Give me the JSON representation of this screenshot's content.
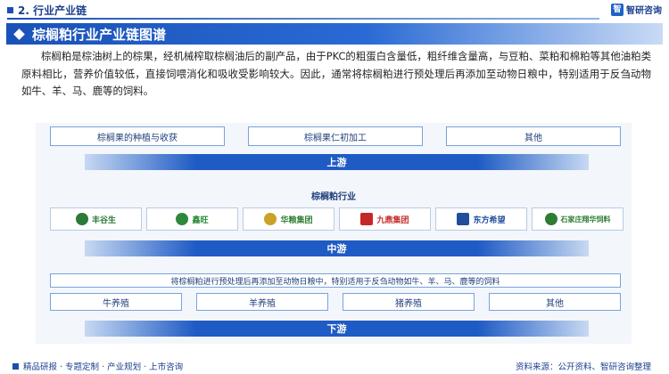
{
  "header": {
    "section": "2. 行业产业链",
    "brand": "智研咨询",
    "brand_mark": "智"
  },
  "title": "棕榈粕行业产业链图谱",
  "paragraph": "棕榈粕是棕油树上的棕果，经机械榨取棕榈油后的副产品，由于PKC的粗蛋白含量低，粗纤维含量高，与豆粕、菜粕和棉粕等其他油粕类原料相比，营养价值较低，直接饲喂消化和吸收受影响较大。因此，通常将棕榈粕进行预处理后再添加至动物日粮中，特别适用于反刍动物如牛、羊、马、鹿等的饲料。",
  "upstream": {
    "items": [
      "棕榈果的种植与收获",
      "棕榈果仁初加工",
      "其他"
    ],
    "band": "上游"
  },
  "midstream": {
    "label": "棕榈粕行业",
    "band": "中游",
    "logos": [
      {
        "text": "丰谷生",
        "color": "#2b7a3a",
        "icon": "leaf-logo-icon"
      },
      {
        "text": "鑫旺",
        "color": "#2d8a3c",
        "icon": "leaf-logo-icon"
      },
      {
        "text": "华粮集团",
        "color": "#2e7d32",
        "icon": "wheat-logo-icon"
      },
      {
        "text": "九鼎集团",
        "color": "#c62828",
        "icon": "cross-logo-icon"
      },
      {
        "text": "东方希望",
        "color": "#1f4f9c",
        "icon": "square-logo-icon"
      },
      {
        "text": "石家庄翔华饲料",
        "color": "#2e7d32",
        "icon": "circle-logo-icon"
      }
    ]
  },
  "downstream": {
    "desc": "将棕榈粕进行预处理后再添加至动物日粮中，特别适用于反刍动物如牛、羊、马、鹿等的饲料",
    "items": [
      "牛养殖",
      "羊养殖",
      "猪养殖",
      "其他"
    ],
    "band": "下游"
  },
  "footer": {
    "left": "精品研报 · 专题定制 · 产业规划 · 上市咨询",
    "source": "资料来源：公开资料、智研咨询整理"
  }
}
